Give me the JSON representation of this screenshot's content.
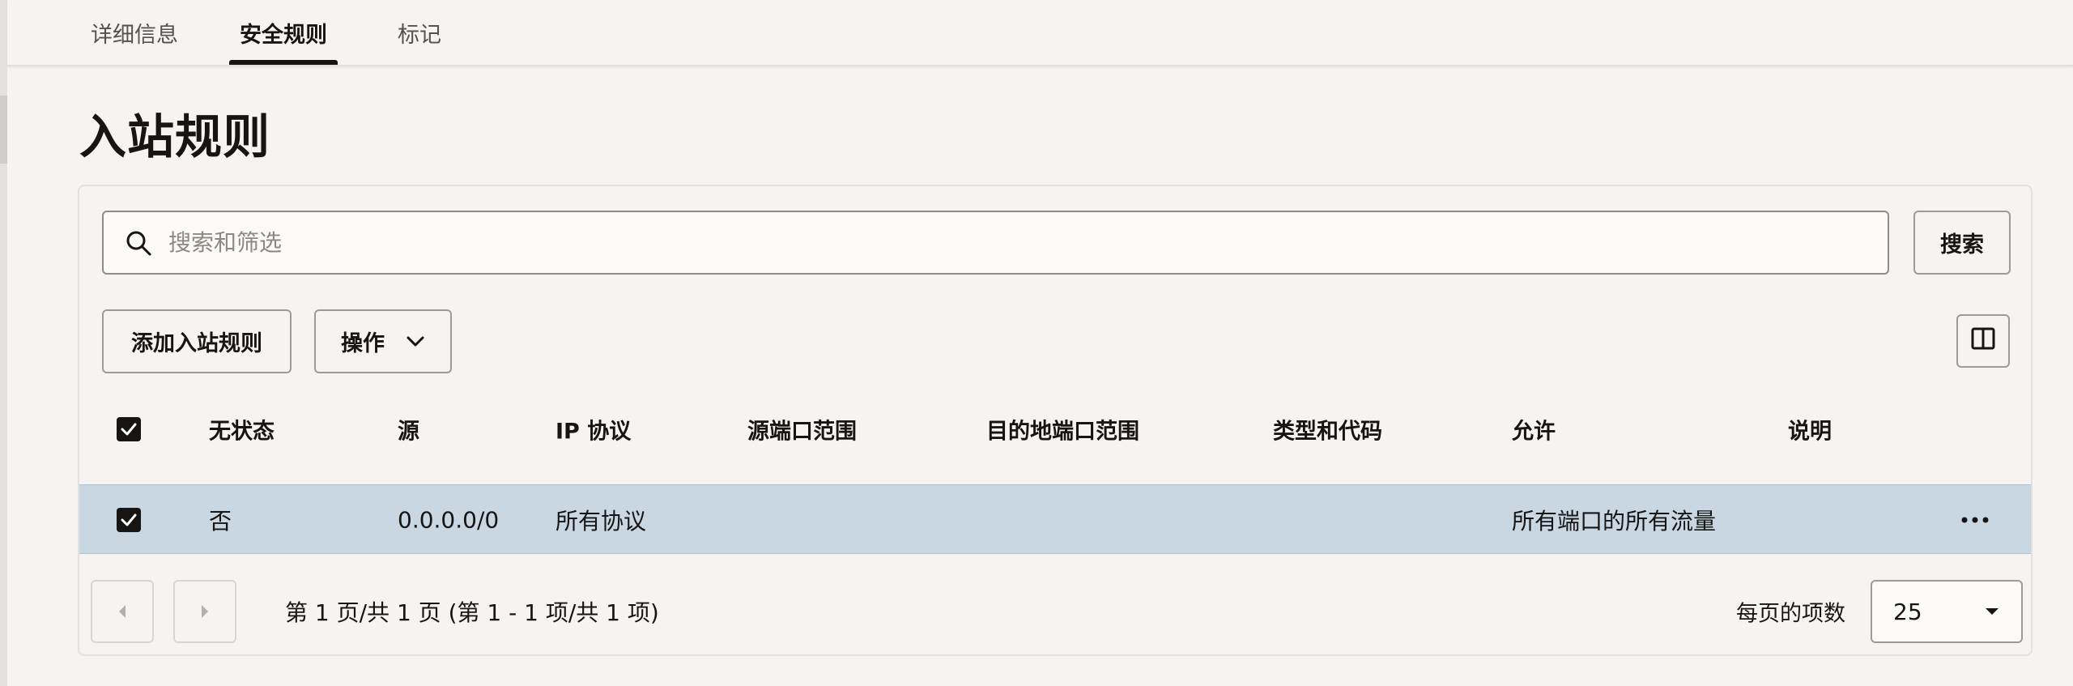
{
  "tabs": {
    "details": "详细信息",
    "security_rules": "安全规则",
    "tags": "标记"
  },
  "page": {
    "title": "入站规则"
  },
  "search": {
    "placeholder": "搜索和筛选",
    "button": "搜索"
  },
  "toolbar": {
    "add_rule": "添加入站规则",
    "actions": "操作"
  },
  "table": {
    "headers": {
      "stateless": "无状态",
      "source": "源",
      "ip_protocol": "IP 协议",
      "source_port_range": "源端口范围",
      "dest_port_range": "目的地端口范围",
      "type_and_code": "类型和代码",
      "allows": "允许",
      "description": "说明"
    },
    "rows": [
      {
        "stateless": "否",
        "source": "0.0.0.0/0",
        "ip_protocol": "所有协议",
        "source_port_range": "",
        "dest_port_range": "",
        "type_and_code": "",
        "allows": "所有端口的所有流量",
        "description": ""
      }
    ]
  },
  "pagination": {
    "summary": "第 1 页/共 1 页 (第 1 - 1 项/共 1 项)",
    "per_page_label": "每页的项数",
    "per_page_value": "25"
  },
  "colors": {
    "selected_row": "#c8d7e2",
    "text": "#161513",
    "background": "#f5f4f2"
  }
}
